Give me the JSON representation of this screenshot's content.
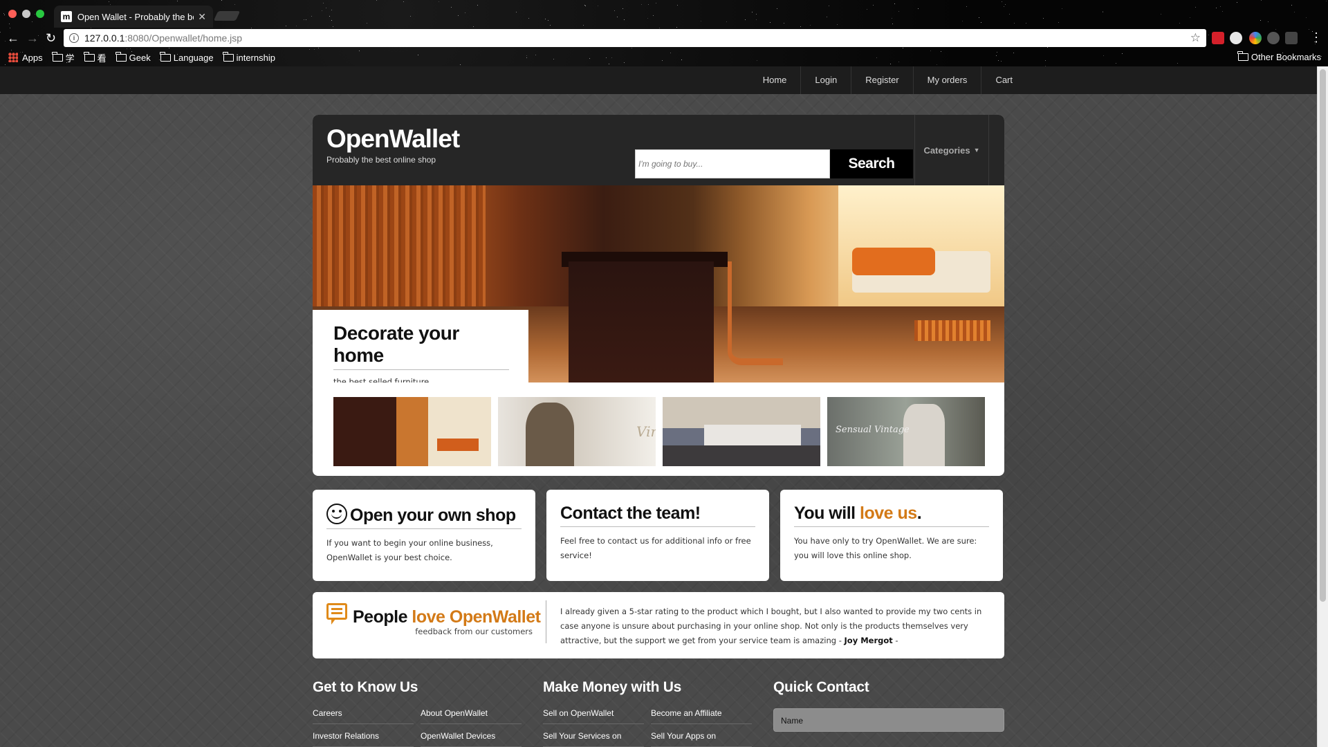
{
  "browser": {
    "tab_title": "Open Wallet - Probably the be",
    "tab_favicon": "m",
    "url_host": "127.0.0.1",
    "url_rest": ":8080/Openwallet/home.jsp",
    "bookmarks": {
      "apps": "Apps",
      "items": [
        "学",
        "看",
        "Geek",
        "Language",
        "internship"
      ],
      "other": "Other Bookmarks"
    }
  },
  "topnav": {
    "items": [
      "Home",
      "Login",
      "Register",
      "My orders",
      "Cart"
    ]
  },
  "header": {
    "logo": "OpenWallet",
    "tagline": "Probably the best online shop",
    "search_placeholder": "I'm going to buy...",
    "search_button": "Search",
    "categories": "Categories"
  },
  "banner": {
    "title": "Decorate your home",
    "subtitle": "the best selled furniture"
  },
  "thumbs": {
    "thumb4_text": "Sensual Vintage"
  },
  "features": [
    {
      "title": "Open your own shop",
      "body": "If you want to begin your online business, OpenWallet is your best choice."
    },
    {
      "title": "Contact the team!",
      "body": "Feel free to contact us for additional info or free service!"
    },
    {
      "title_pre": "You will ",
      "title_accent": "love us",
      "title_post": ".",
      "body": "You have only to try OpenWallet. We are sure: you will love this online shop."
    }
  ],
  "testimonial": {
    "title_pre": "People ",
    "title_accent": "love OpenWallet",
    "subtitle": "feedback from our customers",
    "quote": "I already given a 5-star rating to the product which I bought, but I also wanted to provide my two cents in case anyone is unsure about purchasing in your online shop. Not only is the products themselves very attractive, but the support we get from your service team is amazing - ",
    "author": "Joy Mergot",
    "author_suffix": " -"
  },
  "footer": {
    "col1": {
      "heading": "Get to Know Us",
      "links": [
        "Careers",
        "About OpenWallet",
        "Investor Relations",
        "OpenWallet Devices"
      ]
    },
    "col2": {
      "heading": "Make Money with Us",
      "links": [
        "Sell on OpenWallet",
        "Become an Affiliate",
        "Sell Your Services on",
        "Sell Your Apps on"
      ]
    },
    "col3": {
      "heading": "Quick Contact",
      "name_placeholder": "Name"
    }
  },
  "colors": {
    "accent": "#d37a17",
    "nav_bg": "#1d1d1d",
    "header_bg": "#262626"
  }
}
